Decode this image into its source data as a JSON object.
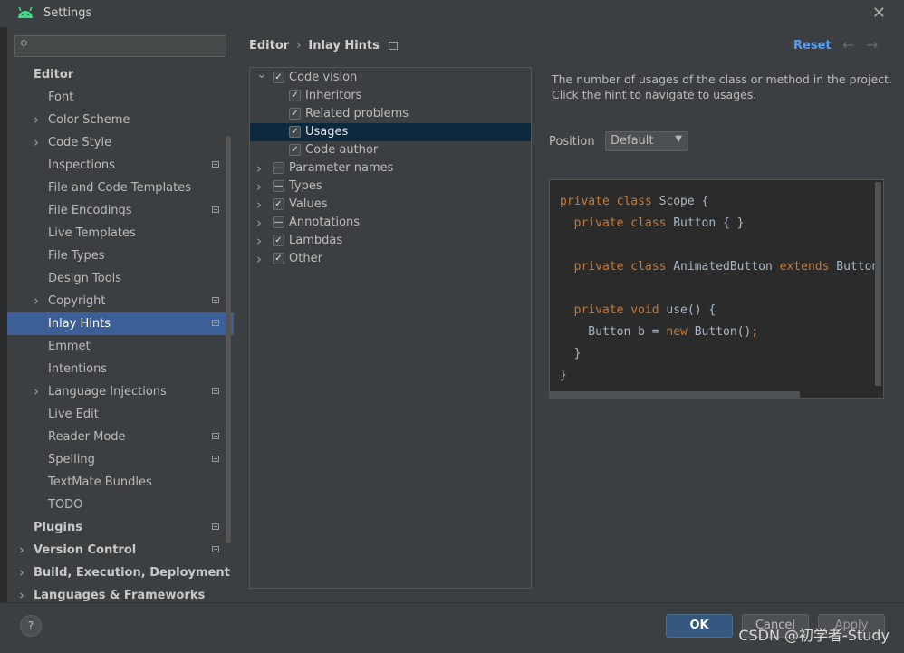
{
  "window": {
    "title": "Settings"
  },
  "search": {
    "placeholder": ""
  },
  "sidebar": {
    "items": [
      {
        "label": "Editor",
        "level": 0,
        "bold": true,
        "expanded": true
      },
      {
        "label": "Font",
        "level": 1
      },
      {
        "label": "Color Scheme",
        "level": 1,
        "expandable": true
      },
      {
        "label": "Code Style",
        "level": 1,
        "expandable": true
      },
      {
        "label": "Inspections",
        "level": 1,
        "pinned": true
      },
      {
        "label": "File and Code Templates",
        "level": 1
      },
      {
        "label": "File Encodings",
        "level": 1,
        "pinned": true
      },
      {
        "label": "Live Templates",
        "level": 1
      },
      {
        "label": "File Types",
        "level": 1
      },
      {
        "label": "Design Tools",
        "level": 1
      },
      {
        "label": "Copyright",
        "level": 1,
        "expandable": true,
        "pinned": true
      },
      {
        "label": "Inlay Hints",
        "level": 1,
        "pinned": true,
        "selected": true
      },
      {
        "label": "Emmet",
        "level": 1
      },
      {
        "label": "Intentions",
        "level": 1
      },
      {
        "label": "Language Injections",
        "level": 1,
        "expandable": true,
        "pinned": true
      },
      {
        "label": "Live Edit",
        "level": 1
      },
      {
        "label": "Reader Mode",
        "level": 1,
        "pinned": true
      },
      {
        "label": "Spelling",
        "level": 1,
        "pinned": true
      },
      {
        "label": "TextMate Bundles",
        "level": 1
      },
      {
        "label": "TODO",
        "level": 1
      },
      {
        "label": "Plugins",
        "level": 0,
        "bold": true,
        "pinned": true
      },
      {
        "label": "Version Control",
        "level": 0,
        "bold": true,
        "expandable": true,
        "pinned": true
      },
      {
        "label": "Build, Execution, Deployment",
        "level": 0,
        "bold": true,
        "expandable": true
      },
      {
        "label": "Languages & Frameworks",
        "level": 0,
        "bold": true,
        "expandable": true
      }
    ]
  },
  "breadcrumb": {
    "parent": "Editor",
    "current": "Inlay Hints",
    "separator": "›"
  },
  "header": {
    "reset_label": "Reset",
    "back_glyph": "←",
    "forward_glyph": "→"
  },
  "hints": {
    "items": [
      {
        "label": "Code vision",
        "level": 0,
        "state": "checked",
        "expanded": true
      },
      {
        "label": "Inheritors",
        "level": 1,
        "state": "checked"
      },
      {
        "label": "Related problems",
        "level": 1,
        "state": "checked"
      },
      {
        "label": "Usages",
        "level": 1,
        "state": "checked",
        "selected": true
      },
      {
        "label": "Code author",
        "level": 1,
        "state": "checked"
      },
      {
        "label": "Parameter names",
        "level": 0,
        "state": "partial",
        "expandable": true
      },
      {
        "label": "Types",
        "level": 0,
        "state": "partial",
        "expandable": true
      },
      {
        "label": "Values",
        "level": 0,
        "state": "checked",
        "expandable": true
      },
      {
        "label": "Annotations",
        "level": 0,
        "state": "partial",
        "expandable": true
      },
      {
        "label": "Lambdas",
        "level": 0,
        "state": "checked",
        "expandable": true
      },
      {
        "label": "Other",
        "level": 0,
        "state": "checked",
        "expandable": true
      }
    ]
  },
  "description": {
    "line1": "The number of usages of the class or method in the project.",
    "line2": "Click the hint to navigate to usages."
  },
  "position": {
    "label": "Position",
    "value": "Default"
  },
  "code_preview": {
    "lines": [
      [
        {
          "t": "private class ",
          "k": true
        },
        {
          "t": "Scope {"
        }
      ],
      [
        {
          "t": "  "
        },
        {
          "t": "private class ",
          "k": true
        },
        {
          "t": "Button { }"
        }
      ],
      [
        {
          "t": ""
        }
      ],
      [
        {
          "t": "  "
        },
        {
          "t": "private class ",
          "k": true
        },
        {
          "t": "AnimatedButton "
        },
        {
          "t": "extends ",
          "k": true
        },
        {
          "t": "Button"
        }
      ],
      [
        {
          "t": ""
        }
      ],
      [
        {
          "t": "  "
        },
        {
          "t": "private void ",
          "k": true
        },
        {
          "t": "use() {"
        }
      ],
      [
        {
          "t": "    Button b = "
        },
        {
          "t": "new ",
          "k": true
        },
        {
          "t": "Button()"
        },
        {
          "t": ";",
          "k": true
        }
      ],
      [
        {
          "t": "  }"
        }
      ],
      [
        {
          "t": "}"
        }
      ]
    ]
  },
  "footer": {
    "help_label": "?",
    "ok_label": "OK",
    "cancel_label": "Cancel",
    "apply_label": "Apply"
  },
  "watermark": {
    "text": "CSDN @初学者-Study"
  },
  "colors": {
    "accent": "#589df6",
    "keyword": "#cc7832",
    "code_text": "#a9b7c6",
    "selection": "#3d5f97"
  }
}
